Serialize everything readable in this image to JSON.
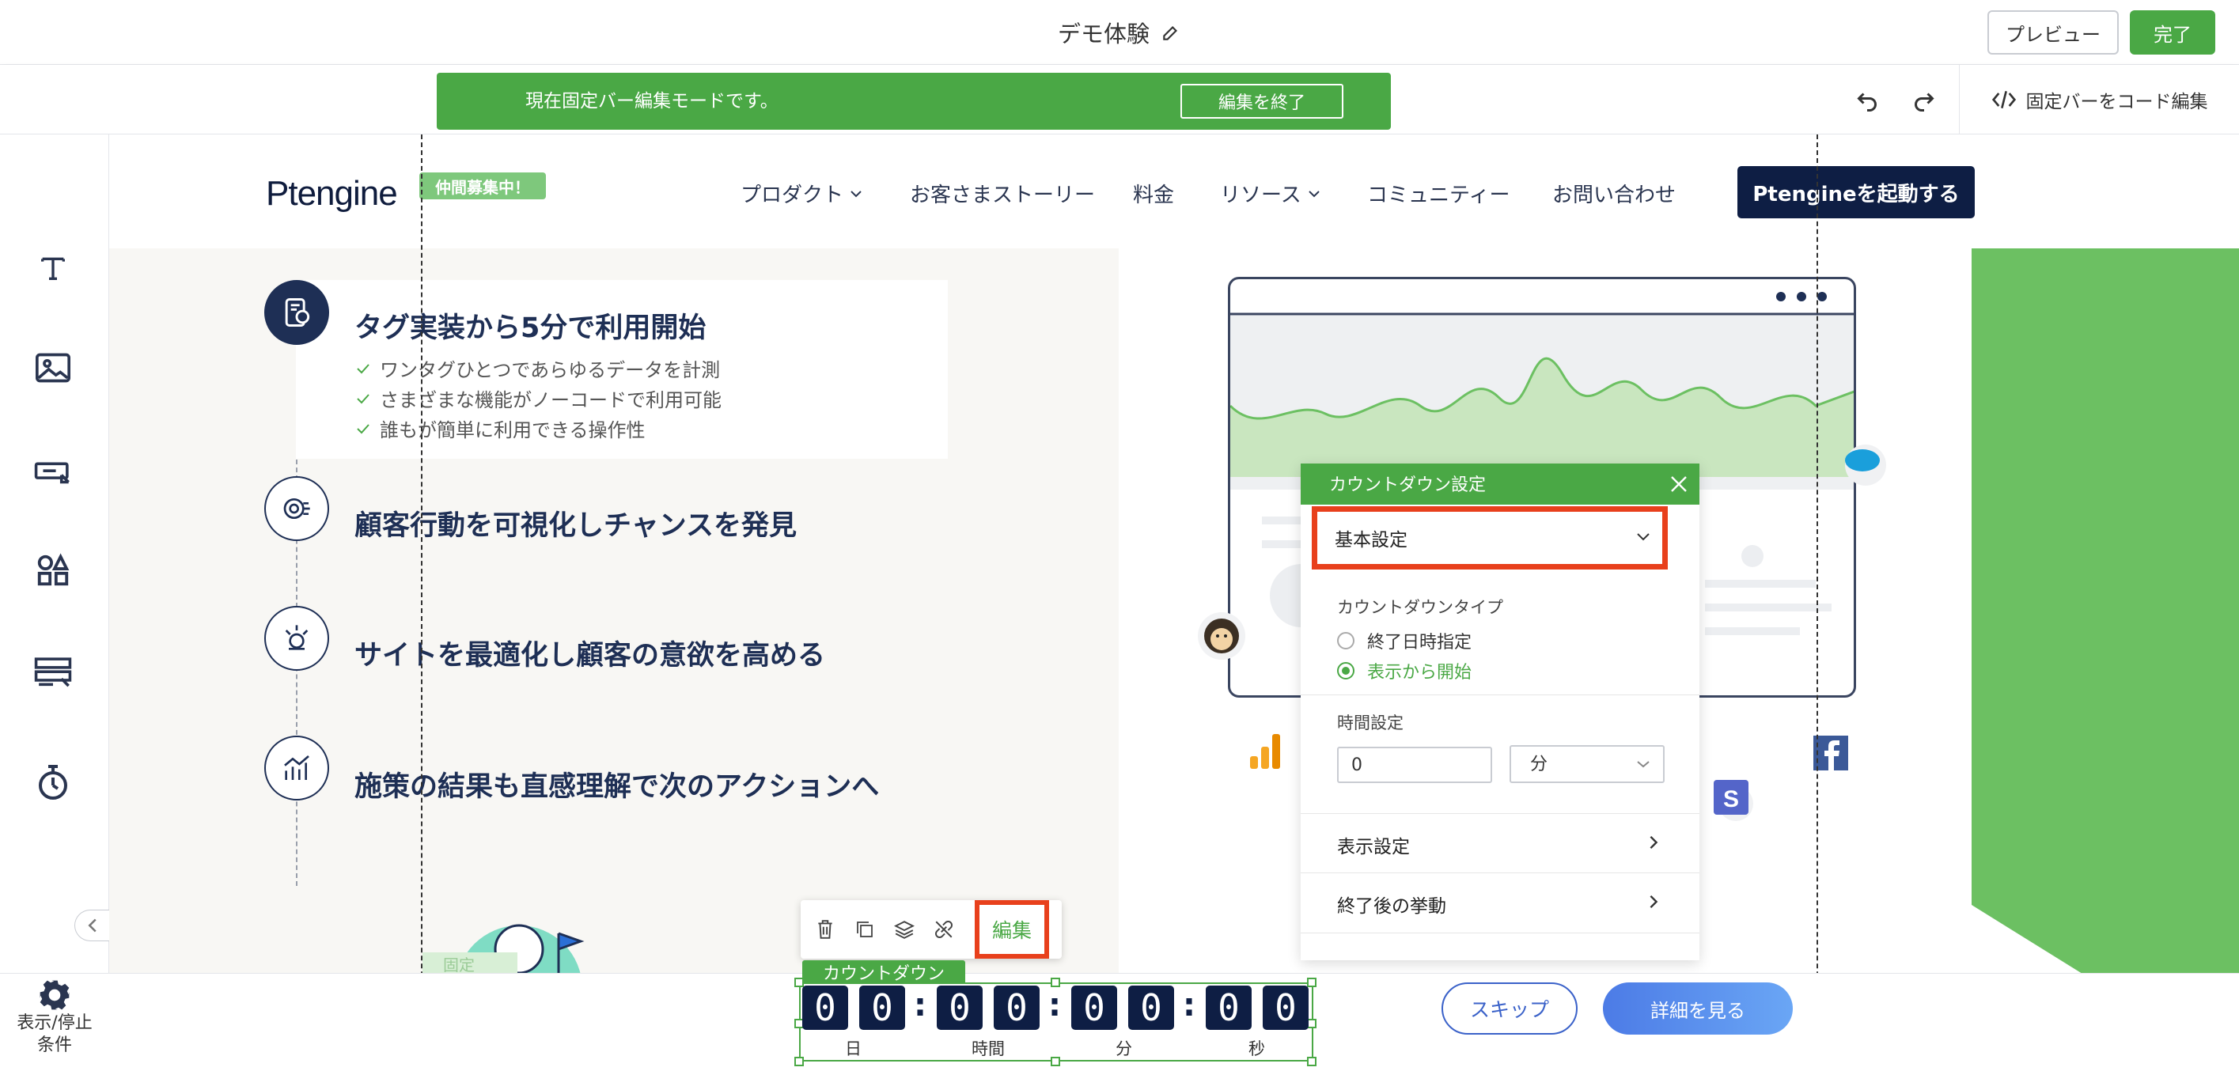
{
  "header": {
    "title": "デモ体験",
    "preview_label": "プレビュー",
    "done_label": "完了"
  },
  "toolbar": {
    "banner_text": "現在固定バー編集モードです。",
    "end_edit_label": "編集を終了",
    "code_edit_label": "固定バーをコード編集"
  },
  "sidebar": {
    "settings_label_1": "表示/停止",
    "settings_label_2": "条件"
  },
  "site": {
    "logo": "Ptengine",
    "recruit_badge": "仲間募集中！",
    "nav": [
      "プロダクト",
      "お客さまストーリー",
      "料金",
      "リソース",
      "コミュニティー",
      "お問い合わせ"
    ],
    "cta": "Ptengineを起動する",
    "features": [
      {
        "title": "タグ実装から5分で利用開始"
      },
      {
        "title": "顧客行動を可視化しチャンスを発見"
      },
      {
        "title": "サイトを最適化し顧客の意欲を高める"
      },
      {
        "title": "施策の結果も直感理解で次のアクションへ"
      }
    ],
    "checks": [
      "ワンタグひとつであらゆるデータを計測",
      "さまざまな機能がノーコードで利用可能",
      "誰もが簡単に利用できる操作性"
    ],
    "fixed_tag": "固定"
  },
  "countdown_panel": {
    "title": "カウントダウン設定",
    "basic_settings": "基本設定",
    "type_label": "カウントダウンタイプ",
    "option_end_date": "終了日時指定",
    "option_from_display": "表示から開始",
    "time_label": "時間設定",
    "time_value": "0",
    "time_unit": "分",
    "display_settings": "表示設定",
    "after_end": "終了後の挙動"
  },
  "element_toolbar": {
    "edit_label": "編集"
  },
  "fixed_bar": {
    "countdown_tag": "カウントダウン",
    "digits": [
      "0",
      "0",
      "0",
      "0",
      "0",
      "0",
      "0",
      "0"
    ],
    "units": [
      "日",
      "時間",
      "分",
      "秒"
    ],
    "skip_label": "スキップ",
    "detail_label": "詳細を見る"
  },
  "colors": {
    "accent_green": "#4aa845",
    "navy": "#0e1e44",
    "highlight_red": "#e8401c",
    "button_blue": "#3b62c9"
  }
}
